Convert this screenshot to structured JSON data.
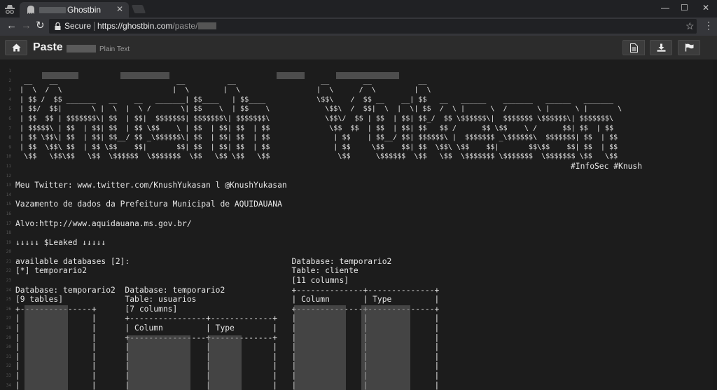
{
  "browser": {
    "tab_title": "Ghostbin",
    "tab_close": "✕",
    "secure_label": "Secure",
    "url_host": "https://ghostbin.com",
    "url_path": "/paste/",
    "window_controls": [
      "—",
      "☐",
      "✕"
    ],
    "nav": {
      "back": "←",
      "forward": "→",
      "reload": "↻"
    }
  },
  "header": {
    "title": "Paste",
    "type": "Plain Text"
  },
  "paste": {
    "line_numbers": [
      "1",
      "2",
      "3",
      "4",
      "5",
      "6",
      "7",
      "8",
      "9",
      "10",
      "11",
      "12",
      "13",
      "14",
      "15",
      "16",
      "17",
      "18",
      "19",
      "20",
      "21",
      "22",
      "23",
      "24",
      "25",
      "26",
      "27",
      "28",
      "29",
      "30",
      "31",
      "32",
      "33",
      "34"
    ],
    "ascii_art": [
      "",
      "  __    __                            __          __                    __        __           __",
      " |  \\  /  \\                          |  \\        |  \\                  |  \\      /  \\         |  \\",
      " | $$ /  $$ _______   __    __   _______| $$____   | $$____            \\$$\\    /  $$ __    __| $$   __   ______    _______   ______   _______",
      " | $$/  $$|       \\ |  \\  |  \\ /       \\| $$    \\  | $$    \\             \\$$\\  /  $$|  \\  |  \\| $$  /  \\ |      \\  /       \\ |      \\ |       \\",
      " | $$  $$ | $$$$$$$\\| $$  | $$|  $$$$$$$| $$$$$$$\\| $$$$$$$\\             \\$$\\/  $$ | $$  | $$| $$_/  $$ \\$$$$$$\\|  $$$$$$$ \\$$$$$$\\| $$$$$$$\\",
      " | $$$$$\\ | $$  | $$| $$  | $$ \\$$    \\ | $$  | $$| $$  | $$              \\$$  $$  | $$  | $$| $$   $$ /      $$ \\$$    \\ /      $$| $$  | $$",
      " | $$ \\$$\\| $$  | $$| $$__/ $$ _\\$$$$$$\\| $$  | $$| $$  | $$               | $$    | $$__/ $$| $$$$$$\\ |  $$$$$$$ _\\$$$$$$\\  $$$$$$$| $$  | $$",
      " | $$  \\$$\\ $$  | $$ \\$$    $$|       $$| $$  | $$| $$  | $$               | $$     \\$$    $$| $$  \\$$\\ \\$$    $$|       $$\\$$    $$| $$  | $$",
      "  \\$$   \\$$\\$$   \\$$  \\$$$$$$  \\$$$$$$$  \\$$   \\$$ \\$$   \\$$                \\$$      \\$$$$$$  \\$$   \\$$  \\$$$$$$$ \\$$$$$$$  \\$$$$$$$ \\$$   \\$$"
    ],
    "hashtags": "#InfoSec #Knush",
    "blank": "",
    "twitter": "Meu Twitter: www.twitter.com/KnushYukasan l @KnushYukasan",
    "vazamento": "Vazamento de dados da Prefeitura Municipal de AQUIDAUANA",
    "alvo": "Alvo:http://www.aquidauana.ms.gov.br/",
    "leaked": "↓↓↓↓↓ $Leaked ↓↓↓↓↓",
    "rows": [
      "available databases [2]:                                  Database: temporario2",
      "[*] temporario2                                           Table: cliente",
      "                                                          [11 columns]",
      "Database: temporario2  Database: temporario2              +--------------+--------------+",
      "[9 tables]             Table: usuarios                    | Column       | Type         |",
      "+---------------+      [7 columns]                        +--------------+--------------+",
      "|               |      +----------------+-------------+   |              |              |",
      "|               |      | Column         | Type        |   |              |              |",
      "|               |      +----------------+-------------+   |              |              |",
      "|               |      |                |             |   |              |              |",
      "|               |      |                |             |   |              |              |",
      "|               |      |                |             |   |              |              |",
      "|               |      |                |             |   |              |              |",
      "|               |      |                |             |   |              |              |",
      "|               |      |                |             |   |              |              |"
    ]
  },
  "colors": {
    "background": "#1c1c1c",
    "header": "#2c2c2c",
    "text": "#e6e6e6"
  }
}
